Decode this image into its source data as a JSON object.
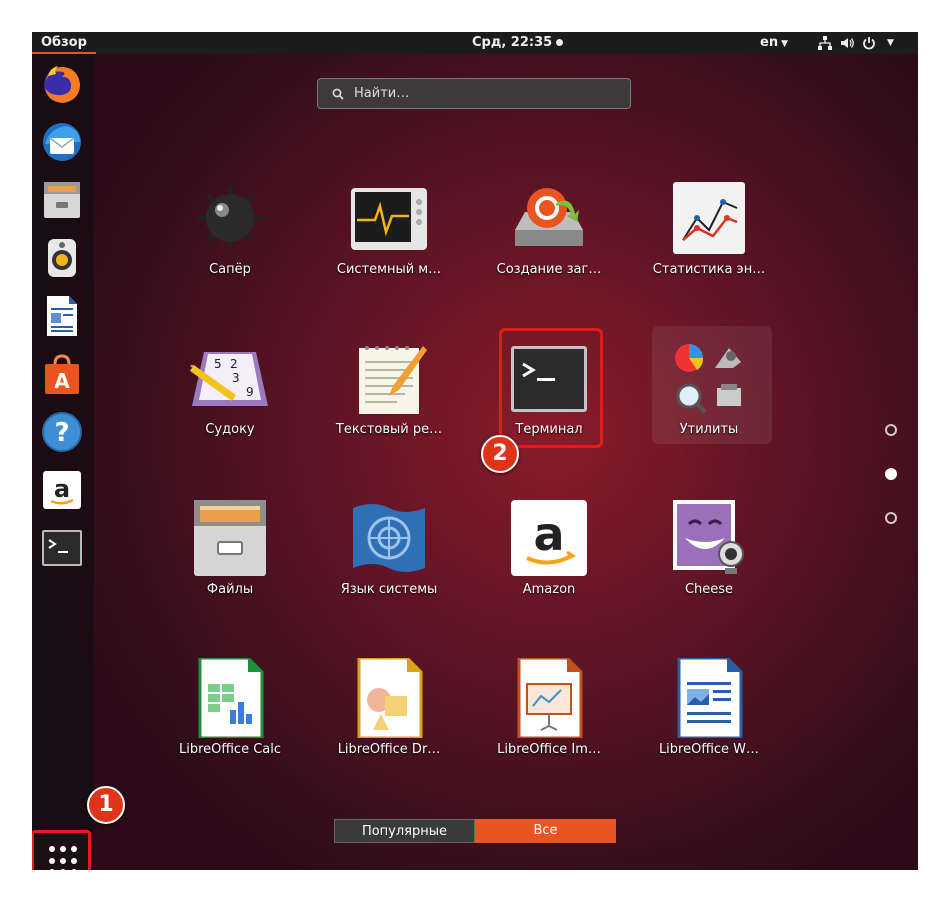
{
  "topbar": {
    "activities": "Обзор",
    "clock": "Срд, 22:35",
    "language": "en"
  },
  "search": {
    "placeholder": "Найти…"
  },
  "dock": [
    {
      "name": "firefox",
      "icon": "firefox-icon"
    },
    {
      "name": "thunderbird",
      "icon": "thunderbird-icon"
    },
    {
      "name": "files",
      "icon": "file-cabinet-icon"
    },
    {
      "name": "rhythmbox",
      "icon": "speaker-icon"
    },
    {
      "name": "writer",
      "icon": "document-icon"
    },
    {
      "name": "software",
      "icon": "shopping-bag-icon"
    },
    {
      "name": "help",
      "icon": "help-icon"
    },
    {
      "name": "amazon",
      "icon": "amazon-icon"
    },
    {
      "name": "terminal",
      "icon": "terminal-icon"
    }
  ],
  "apps": [
    {
      "label": "Сапёр"
    },
    {
      "label": "Системный м…"
    },
    {
      "label": "Создание заг…"
    },
    {
      "label": "Статистика эн…"
    },
    {
      "label": "Судоку"
    },
    {
      "label": "Текстовый ре…"
    },
    {
      "label": "Терминал"
    },
    {
      "label": "Утилиты"
    },
    {
      "label": "Файлы"
    },
    {
      "label": "Язык системы"
    },
    {
      "label": "Amazon"
    },
    {
      "label": "Cheese"
    },
    {
      "label": "LibreOffice Calc"
    },
    {
      "label": "LibreOffice Dr…"
    },
    {
      "label": "LibreOffice Im…"
    },
    {
      "label": "LibreOffice W…"
    }
  ],
  "badges": {
    "one": "1",
    "two": "2"
  },
  "switcher": {
    "popular": "Популярные",
    "all": "Все"
  },
  "colors": {
    "accent": "#e95420",
    "highlight": "#e51a1a"
  }
}
